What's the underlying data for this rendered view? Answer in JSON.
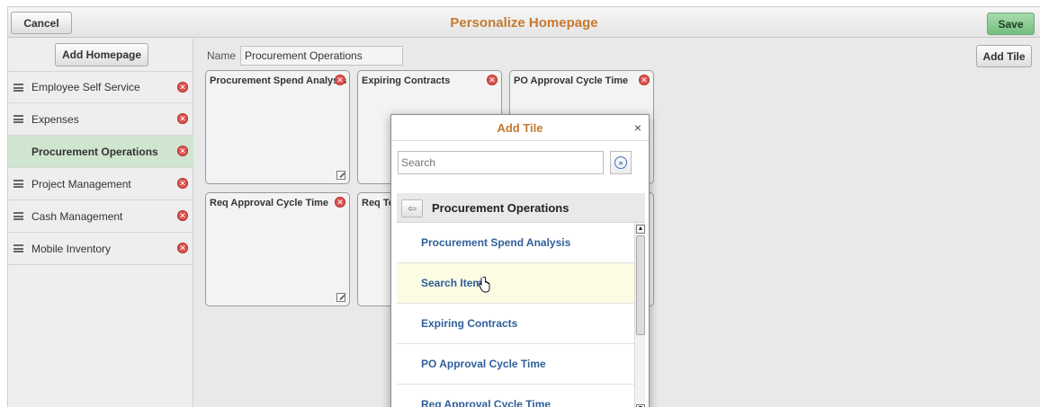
{
  "header": {
    "cancel_label": "Cancel",
    "title": "Personalize Homepage",
    "save_label": "Save"
  },
  "left_panel": {
    "add_homepage_label": "Add Homepage",
    "homepages": [
      {
        "label": "Employee Self Service",
        "selected": false
      },
      {
        "label": "Expenses",
        "selected": false
      },
      {
        "label": "Procurement Operations",
        "selected": true
      },
      {
        "label": "Project Management",
        "selected": false
      },
      {
        "label": "Cash Management",
        "selected": false
      },
      {
        "label": "Mobile Inventory",
        "selected": false
      }
    ]
  },
  "main": {
    "name_label": "Name",
    "name_value": "Procurement Operations",
    "add_tile_label": "Add Tile",
    "tiles": [
      {
        "label": "Procurement Spend Analysis"
      },
      {
        "label": "Expiring Contracts"
      },
      {
        "label": "PO Approval Cycle Time"
      },
      {
        "label": "Req Approval Cycle Time"
      },
      {
        "label": "Req To"
      }
    ]
  },
  "dialog": {
    "title": "Add Tile",
    "close_glyph": "×",
    "search_placeholder": "Search",
    "search_button_glyph": "»",
    "back_glyph": "⇦",
    "group_title": "Procurement Operations",
    "items": [
      {
        "label": "Procurement Spend Analysis"
      },
      {
        "label": "Search Items"
      },
      {
        "label": "Expiring Contracts"
      },
      {
        "label": "PO Approval Cycle Time"
      },
      {
        "label": "Req Approval Cycle Time"
      }
    ],
    "scroll_up_glyph": "▲",
    "scroll_down_glyph": "▼"
  },
  "colors": {
    "title_accent": "#c47a30",
    "link_blue": "#2f5f9a",
    "selected_bg": "#cfe5cf",
    "save_green": "#73bd7d",
    "delete_red": "#d9534f"
  }
}
